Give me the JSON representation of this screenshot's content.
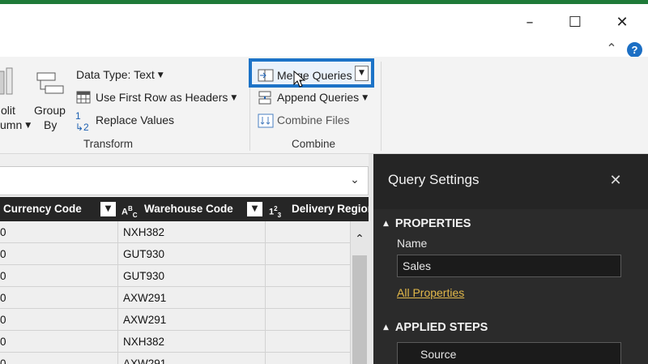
{
  "window": {
    "minimize_icon": "minimize-icon",
    "maximize_icon": "maximize-icon",
    "close_icon": "close-icon",
    "help_label": "?"
  },
  "ribbon": {
    "split_column": {
      "label_line1": "olit",
      "label_line2": "umn"
    },
    "group_by": {
      "label_line1": "Group",
      "label_line2": "By"
    },
    "data_type": "Data Type: Text",
    "use_first_row": "Use First Row as Headers",
    "replace_values": "Replace Values",
    "transform_group": "Transform",
    "merge_queries": "Merge Queries",
    "append_queries": "Append Queries",
    "combine_files": "Combine Files",
    "combine_group": "Combine"
  },
  "grid": {
    "columns": [
      {
        "name": "Currency Code",
        "type_icon": ""
      },
      {
        "name": "Warehouse Code",
        "type_icon": "ABC"
      },
      {
        "name": "Delivery Regior",
        "type_icon": "123"
      }
    ],
    "rows": [
      {
        "currency": "0",
        "warehouse": "NXH382",
        "delivery": ""
      },
      {
        "currency": "0",
        "warehouse": "GUT930",
        "delivery": ""
      },
      {
        "currency": "0",
        "warehouse": "GUT930",
        "delivery": ""
      },
      {
        "currency": "0",
        "warehouse": "AXW291",
        "delivery": ""
      },
      {
        "currency": "0",
        "warehouse": "AXW291",
        "delivery": ""
      },
      {
        "currency": "0",
        "warehouse": "NXH382",
        "delivery": ""
      },
      {
        "currency": "0",
        "warehouse": "AXW291",
        "delivery": ""
      }
    ]
  },
  "query_settings": {
    "title": "Query Settings",
    "properties_header": "PROPERTIES",
    "name_label": "Name",
    "name_value": "Sales",
    "all_properties": "All Properties",
    "applied_steps_header": "APPLIED STEPS",
    "steps": [
      "Source"
    ]
  }
}
